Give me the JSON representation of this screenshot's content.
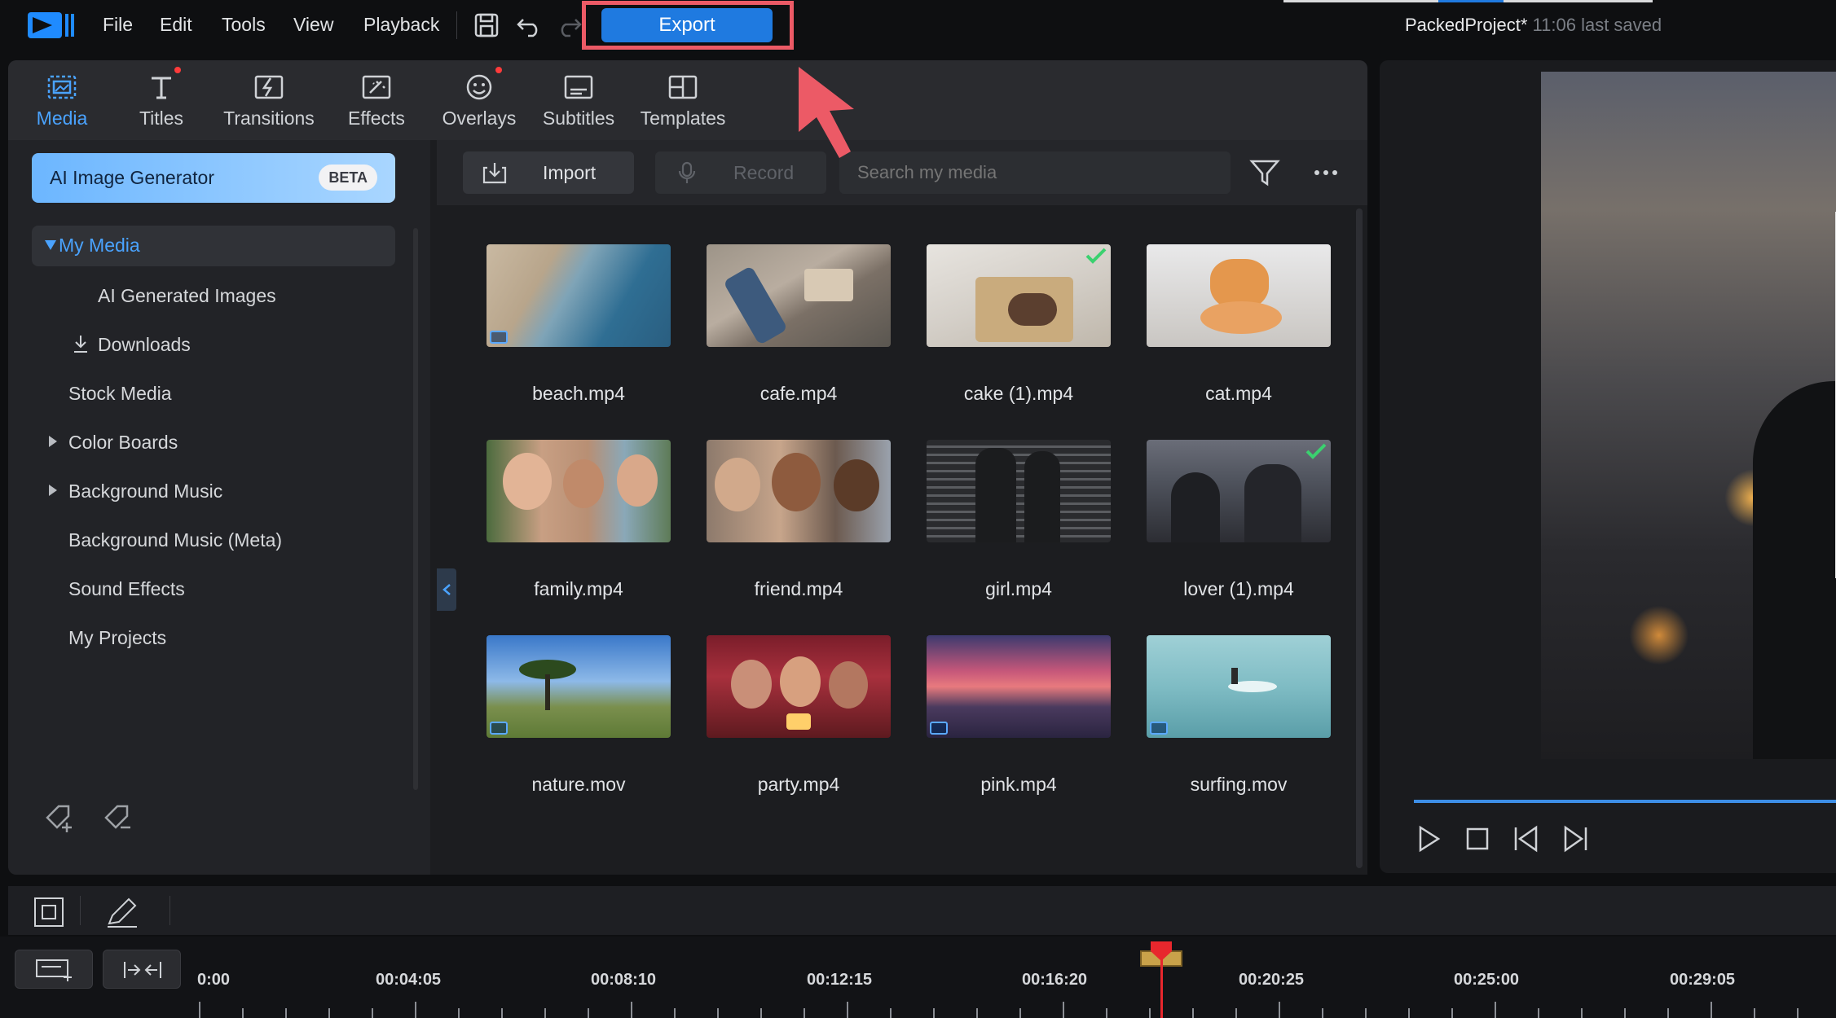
{
  "menu": {
    "items": [
      "File",
      "Edit",
      "Tools",
      "View",
      "Playback"
    ],
    "export_label": "Export",
    "project_name": "PackedProject*",
    "saved_text": "11:06 last saved"
  },
  "tabs": [
    {
      "label": "Media",
      "icon": "media-icon",
      "active": true
    },
    {
      "label": "Titles",
      "icon": "titles-icon",
      "dot": true
    },
    {
      "label": "Transitions",
      "icon": "transitions-icon"
    },
    {
      "label": "Effects",
      "icon": "effects-icon"
    },
    {
      "label": "Overlays",
      "icon": "overlays-icon",
      "dot": true
    },
    {
      "label": "Subtitles",
      "icon": "subtitles-icon"
    },
    {
      "label": "Templates",
      "icon": "templates-icon"
    }
  ],
  "sidebar": {
    "ai_button": "AI Image Generator",
    "beta": "BETA",
    "items": [
      {
        "label": "My Media",
        "selected": true
      },
      {
        "label": "AI Generated Images"
      },
      {
        "label": "Downloads"
      },
      {
        "label": "Stock Media"
      },
      {
        "label": "Color Boards"
      },
      {
        "label": "Background Music"
      },
      {
        "label": "Background Music (Meta)"
      },
      {
        "label": "Sound Effects"
      },
      {
        "label": "My Projects"
      }
    ]
  },
  "toolbar": {
    "import_label": "Import",
    "record_label": "Record",
    "search_placeholder": "Search my media"
  },
  "media": [
    {
      "name": "beach.mp4",
      "video": true
    },
    {
      "name": "cafe.mp4"
    },
    {
      "name": "cake (1).mp4",
      "checked": true
    },
    {
      "name": "cat.mp4"
    },
    {
      "name": "family.mp4"
    },
    {
      "name": "friend.mp4"
    },
    {
      "name": "girl.mp4"
    },
    {
      "name": "lover (1).mp4",
      "checked": true
    },
    {
      "name": "nature.mov",
      "video": true
    },
    {
      "name": "party.mp4"
    },
    {
      "name": "pink.mp4",
      "video": true
    },
    {
      "name": "surfing.mov",
      "video": true
    }
  ],
  "timeline": {
    "ticks": [
      "0:00",
      "00:04:05",
      "00:08:10",
      "00:12:15",
      "00:16:20",
      "00:20:25",
      "00:25:00",
      "00:29:05"
    ]
  },
  "colors": {
    "accent": "#1f7ae0",
    "highlight": "#ec5a66",
    "check": "#3bd16f"
  }
}
